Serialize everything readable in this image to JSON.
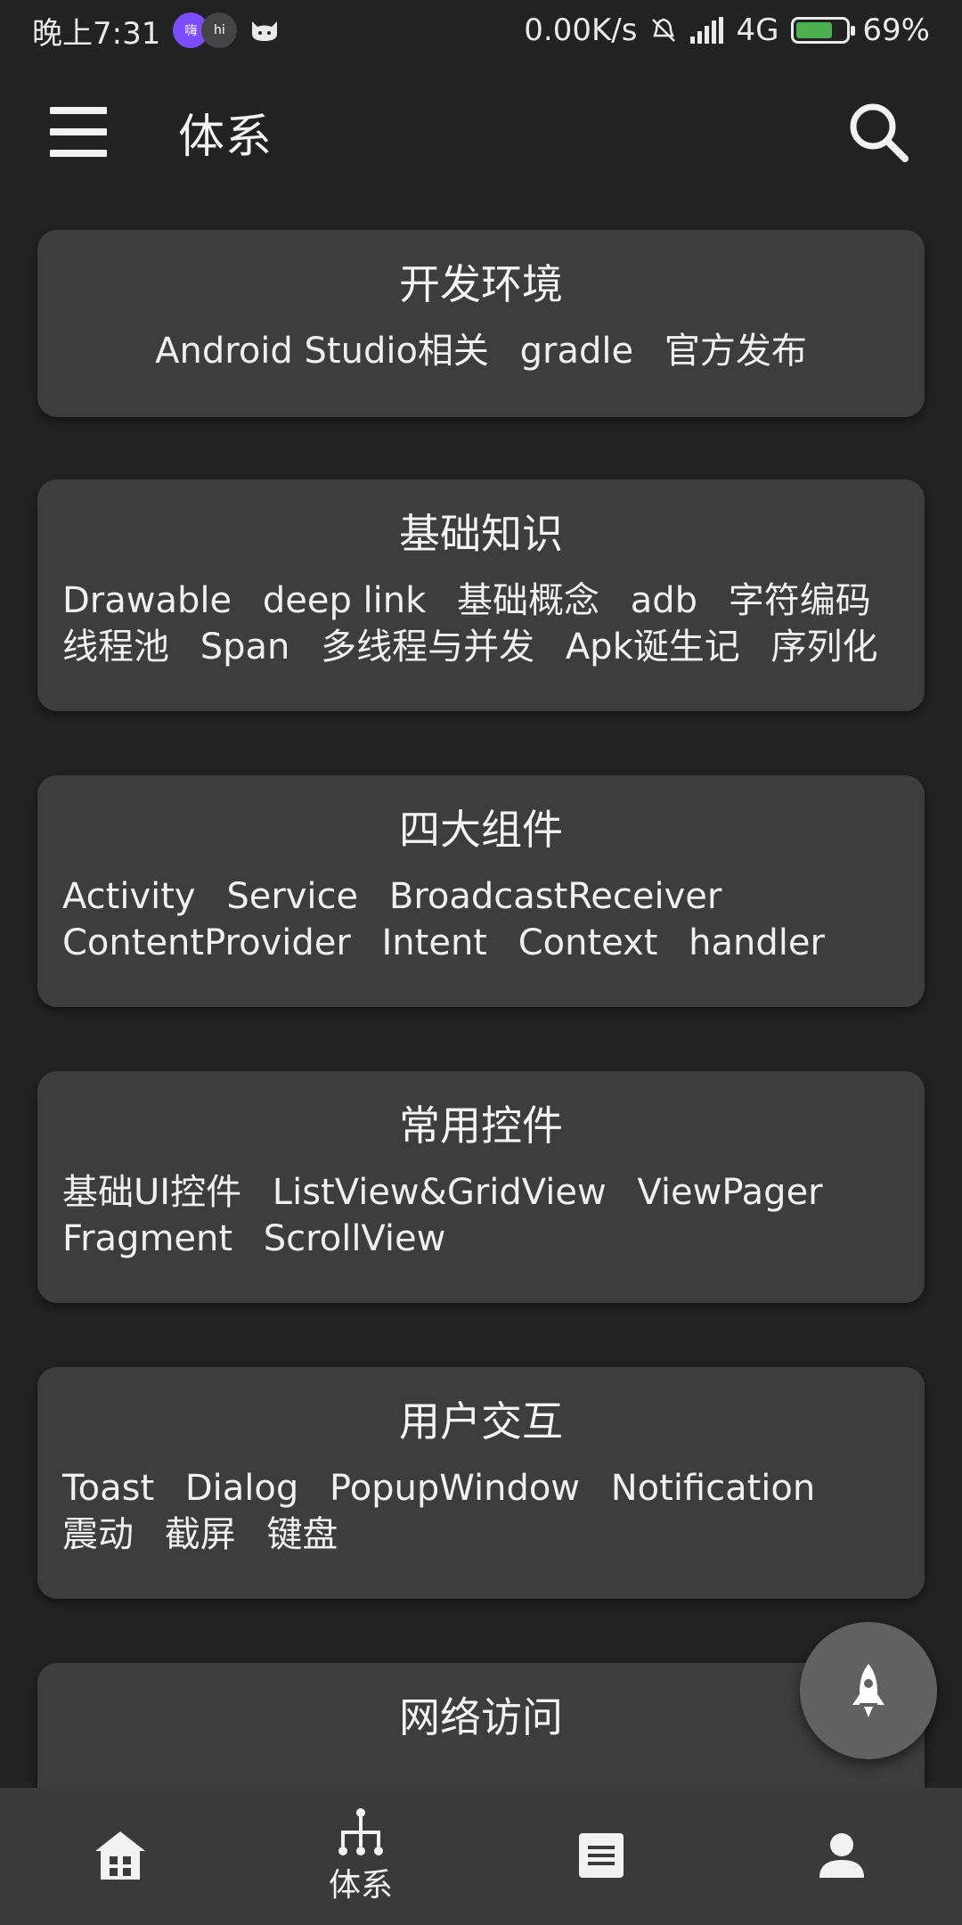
{
  "status_bar": {
    "time": "晚上7:31",
    "net_speed": "0.00K/s",
    "network": "4G",
    "battery": "69%"
  },
  "app_bar": {
    "title": "体系",
    "menu_icon": "menu-icon",
    "search_icon": "search-icon"
  },
  "cards": [
    {
      "title": "开发环境",
      "tags": [
        "Android Studio相关",
        "gradle",
        "官方发布"
      ]
    },
    {
      "title": "基础知识",
      "tags": [
        "Drawable",
        "deep link",
        "基础概念",
        "adb",
        "字符编码",
        "线程池",
        "Span",
        "多线程与并发",
        "Apk诞生记",
        "序列化"
      ]
    },
    {
      "title": "四大组件",
      "tags": [
        "Activity",
        "Service",
        "BroadcastReceiver",
        "ContentProvider",
        "Intent",
        "Context",
        "handler"
      ]
    },
    {
      "title": "常用控件",
      "tags": [
        "基础UI控件",
        "ListView&GridView",
        "ViewPager",
        "Fragment",
        "ScrollView"
      ]
    },
    {
      "title": "用户交互",
      "tags": [
        "Toast",
        "Dialog",
        "PopupWindow",
        "Notification",
        "震动",
        "截屏",
        "键盘"
      ]
    },
    {
      "title": "网络访问",
      "tags": []
    }
  ],
  "fab": {
    "icon": "rocket-icon"
  },
  "bottom_nav": {
    "items": [
      {
        "icon": "home-icon",
        "label": ""
      },
      {
        "icon": "hierarchy-icon",
        "label": "体系"
      },
      {
        "icon": "article-icon",
        "label": ""
      },
      {
        "icon": "person-icon",
        "label": ""
      }
    ]
  },
  "colors": {
    "background": "#222222",
    "card": "#3d3d3d",
    "bottom_nav": "#3a3a3a",
    "fab": "#616161",
    "text": "#f2f2f2"
  }
}
